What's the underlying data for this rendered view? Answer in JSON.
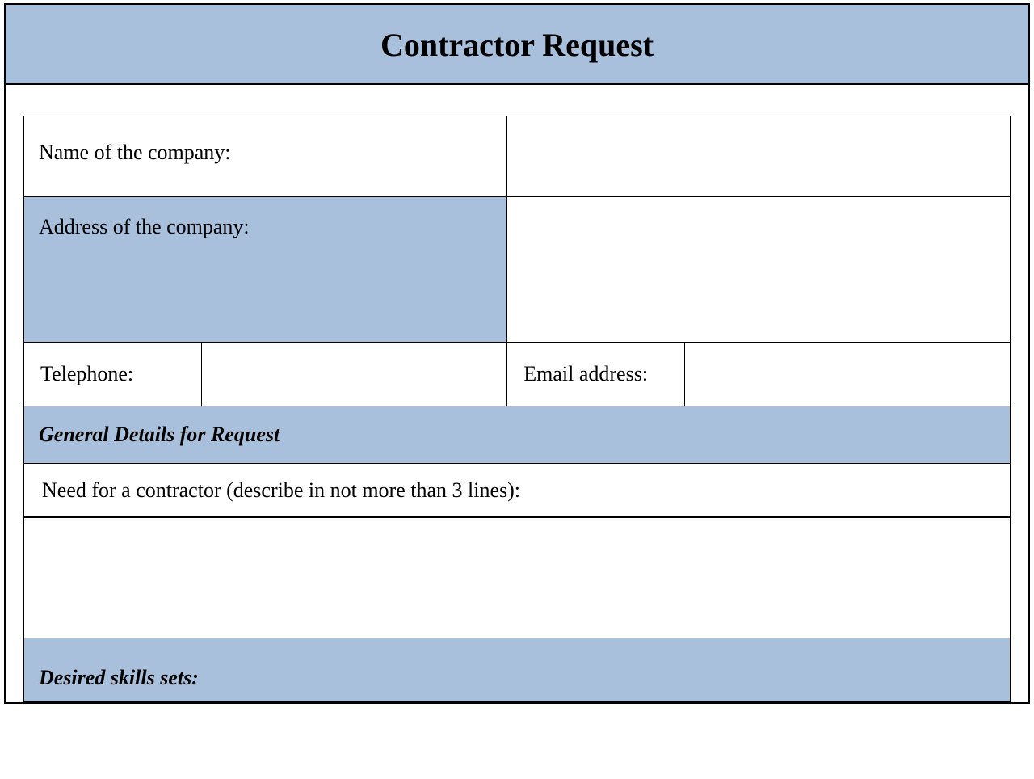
{
  "header": {
    "title": "Contractor Request"
  },
  "fields": {
    "company_name_label": "Name of the company:",
    "company_name_value": "",
    "company_address_label": "Address of the company:",
    "company_address_value": "",
    "telephone_label": "Telephone:",
    "telephone_value": "",
    "email_label": "Email address:",
    "email_value": ""
  },
  "sections": {
    "general_details_heading": "General Details for Request",
    "need_label": "Need for a contractor (describe in not more than 3 lines):",
    "need_value": "",
    "desired_skills_heading": "Desired skills sets:"
  }
}
